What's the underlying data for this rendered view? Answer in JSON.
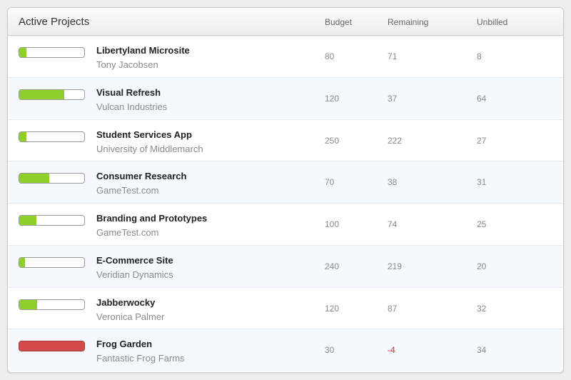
{
  "header": {
    "title": "Active Projects",
    "columns": {
      "budget": "Budget",
      "remaining": "Remaining",
      "unbilled": "Unbilled"
    }
  },
  "colors": {
    "progress_fill": "#8fcf2a",
    "over_budget": "#d44a4a",
    "negative_text": "#d43030",
    "row_alt": "#f5f8fc"
  },
  "projects": [
    {
      "name": "Libertyland Microsite",
      "client": "Tony Jacobsen",
      "budget": "80",
      "remaining": "71",
      "unbilled": "8",
      "progress": 0.11,
      "over": false
    },
    {
      "name": "Visual Refresh",
      "client": "Vulcan Industries",
      "budget": "120",
      "remaining": "37",
      "unbilled": "64",
      "progress": 0.69,
      "over": false
    },
    {
      "name": "Student Services App",
      "client": "University of Middlemarch",
      "budget": "250",
      "remaining": "222",
      "unbilled": "27",
      "progress": 0.11,
      "over": false
    },
    {
      "name": "Consumer Research",
      "client": "GameTest.com",
      "budget": "70",
      "remaining": "38",
      "unbilled": "31",
      "progress": 0.46,
      "over": false
    },
    {
      "name": "Branding and Prototypes",
      "client": "GameTest.com",
      "budget": "100",
      "remaining": "74",
      "unbilled": "25",
      "progress": 0.26,
      "over": false
    },
    {
      "name": "E-Commerce Site",
      "client": "Veridian Dynamics",
      "budget": "240",
      "remaining": "219",
      "unbilled": "20",
      "progress": 0.09,
      "over": false
    },
    {
      "name": "Jabberwocky",
      "client": "Veronica Palmer",
      "budget": "120",
      "remaining": "87",
      "unbilled": "32",
      "progress": 0.27,
      "over": false
    },
    {
      "name": "Frog Garden",
      "client": "Fantastic Frog Farms",
      "budget": "30",
      "remaining": "-4",
      "unbilled": "34",
      "progress": 1.0,
      "over": true
    }
  ]
}
